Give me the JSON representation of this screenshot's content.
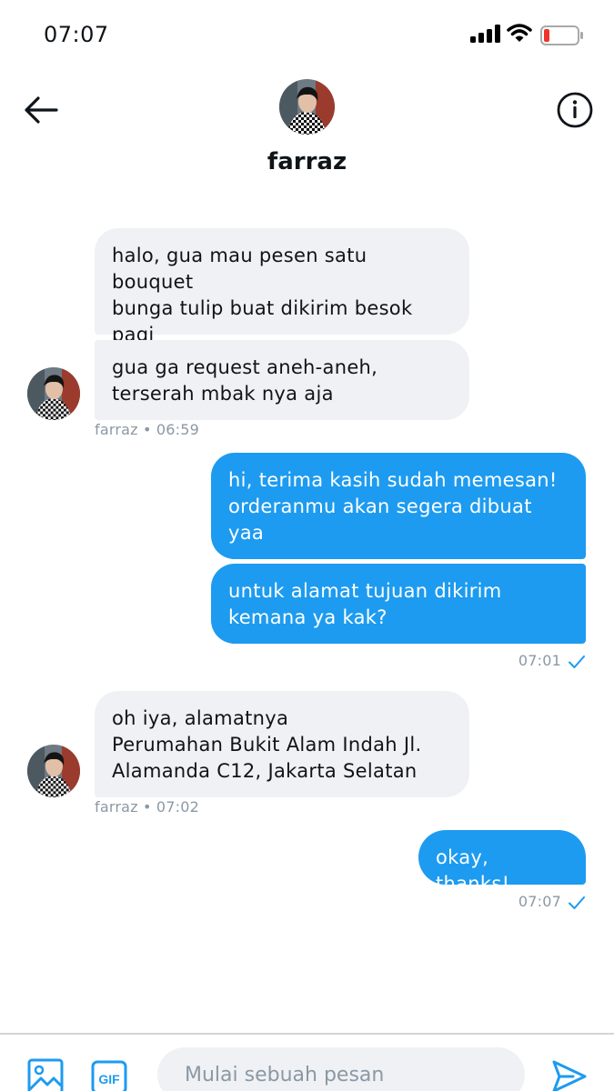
{
  "status_bar": {
    "time": "07:07"
  },
  "header": {
    "name": "farraz"
  },
  "messages": [
    {
      "text": "halo, gua mau pesen satu bouquet\nbunga tulip buat dikirim besok\npagi"
    },
    {
      "text": "gua ga request aneh-aneh,\nterserah mbak nya aja"
    },
    {
      "text": "hi, terima kasih sudah memesan!\norderanmu akan segera dibuat\nyaa"
    },
    {
      "text": "untuk alamat tujuan dikirim\nkemana ya kak?"
    },
    {
      "text": "oh iya, alamatnya\nPerumahan Bukit Alam Indah Jl.\nAlamanda C12, Jakarta Selatan"
    },
    {
      "text": "okay, thanks!"
    }
  ],
  "meta": [
    {
      "text": "farraz • 06:59"
    },
    {
      "text": "07:01"
    },
    {
      "text": "farraz • 07:02"
    },
    {
      "text": "07:07"
    }
  ],
  "composer": {
    "placeholder": "Mulai sebuah pesan",
    "gif_label": "GIF"
  },
  "colors": {
    "accent": "#1d9bf0",
    "incoming_bubble": "#eff1f4",
    "meta_text": "#8b98a5"
  },
  "icons": [
    "back-arrow-icon",
    "info-icon",
    "image-icon",
    "gif-icon",
    "send-icon",
    "read-check-icon"
  ]
}
